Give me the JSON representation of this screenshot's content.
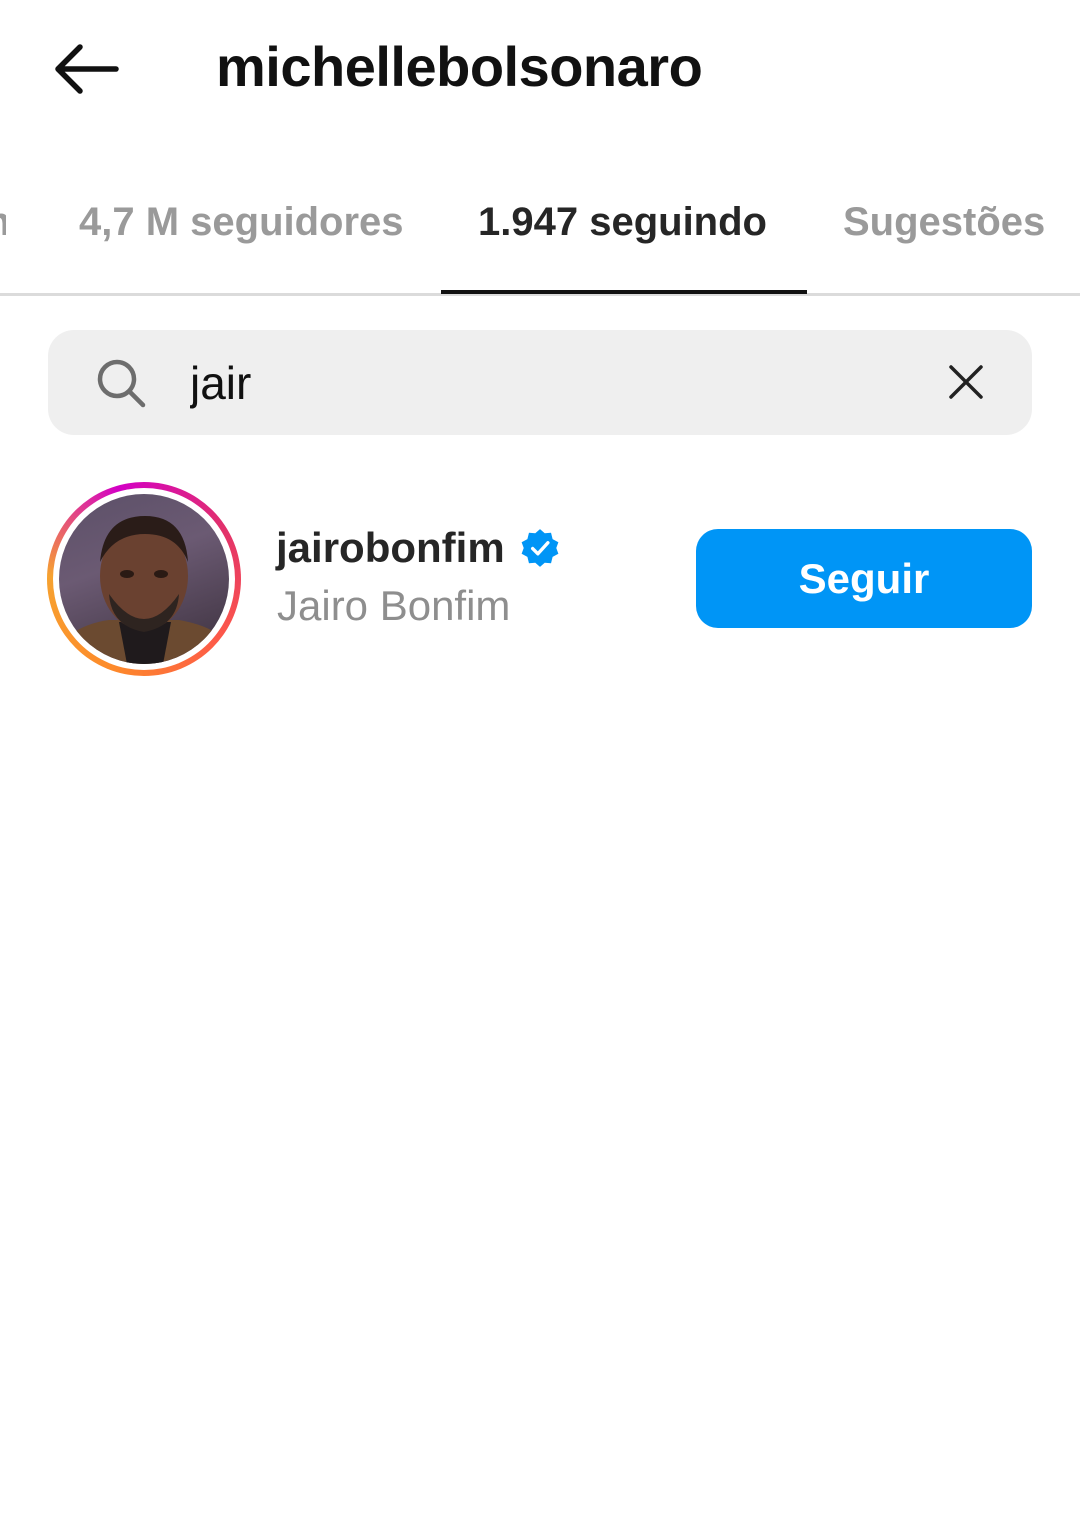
{
  "header": {
    "title": "michellebolsonaro",
    "back_icon": "arrow-left-icon"
  },
  "tabs": [
    {
      "label": "n",
      "active": false
    },
    {
      "label": "4,7 M seguidores",
      "active": false
    },
    {
      "label": "1.947 seguindo",
      "active": true
    },
    {
      "label": "Sugestões",
      "active": false
    }
  ],
  "search": {
    "value": "jair",
    "icon": "search-icon",
    "clear_icon": "close-icon"
  },
  "results": [
    {
      "username": "jairobonfim",
      "full_name": "Jairo Bonfim",
      "verified": true,
      "has_story": true,
      "button_label": "Seguir"
    }
  ],
  "colors": {
    "follow_button": "#0095f6",
    "verified_badge": "#0095f6",
    "inactive_tab": "#9a9a9a",
    "search_bg": "#efefef"
  }
}
